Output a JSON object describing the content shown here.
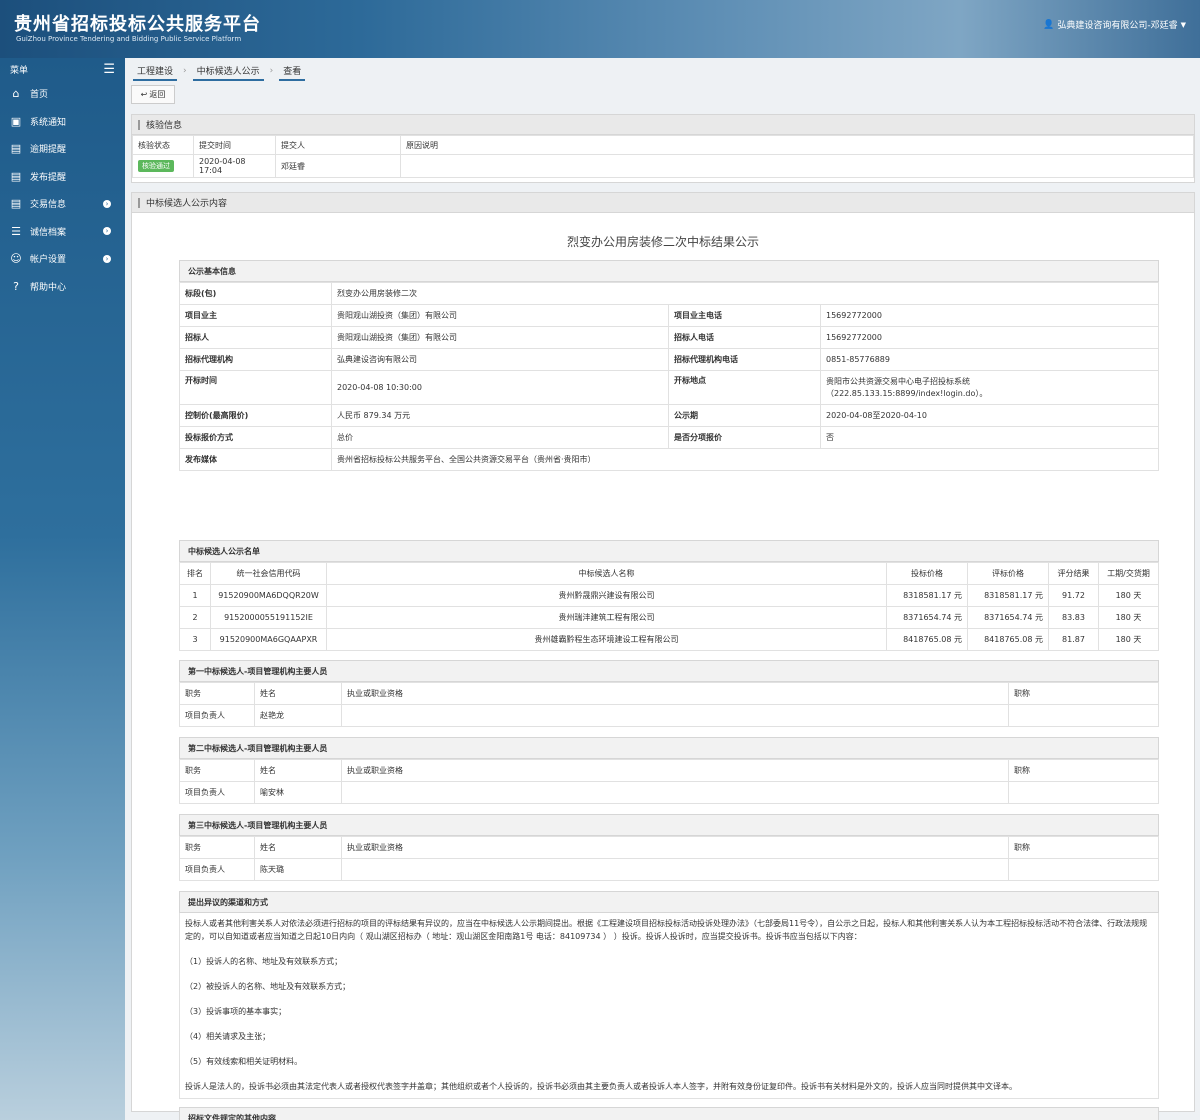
{
  "header": {
    "title": "贵州省招标投标公共服务平台",
    "subtitle": "GuiZhou Province Tendering and Bidding Public Service Platform",
    "user": "弘典建设咨询有限公司-邓廷睿"
  },
  "sidebar": {
    "menu_label": "菜单",
    "items": [
      {
        "label": "首页",
        "icon": "home-icon",
        "expand": false
      },
      {
        "label": "系统通知",
        "icon": "monitor-icon",
        "expand": false
      },
      {
        "label": "逾期提醒",
        "icon": "folder-icon",
        "expand": false
      },
      {
        "label": "发布提醒",
        "icon": "folder-icon",
        "expand": false
      },
      {
        "label": "交易信息",
        "icon": "folder-icon",
        "expand": true
      },
      {
        "label": "诚信档案",
        "icon": "list-icon",
        "expand": true
      },
      {
        "label": "帐户设置",
        "icon": "user-icon",
        "expand": true
      },
      {
        "label": "帮助中心",
        "icon": "help-icon",
        "expand": false
      }
    ]
  },
  "breadcrumb": [
    "工程建设",
    "中标候选人公示",
    "查看"
  ],
  "back_label": "返回",
  "verify": {
    "title": "核验信息",
    "headers": [
      "核验状态",
      "提交时间",
      "提交人",
      "原因说明"
    ],
    "status": "核验通过",
    "time": "2020-04-08 17:04",
    "person": "邓廷睿",
    "reason": ""
  },
  "content": {
    "panel_title": "中标候选人公示内容",
    "doc_title": "烈变办公用房装修二次中标结果公示",
    "basic": {
      "title": "公示基本信息",
      "bid_section_label": "标段(包)",
      "bid_section": "烈变办公用房装修二次",
      "rows": [
        {
          "l1": "项目业主",
          "v1": "贵阳观山湖投资（集团）有限公司",
          "l2": "项目业主电话",
          "v2": "15692772000"
        },
        {
          "l1": "招标人",
          "v1": "贵阳观山湖投资（集团）有限公司",
          "l2": "招标人电话",
          "v2": "15692772000"
        },
        {
          "l1": "招标代理机构",
          "v1": "弘典建设咨询有限公司",
          "l2": "招标代理机构电话",
          "v2": "0851-85776889"
        },
        {
          "l1": "开标时间",
          "v1": "2020-04-08 10:30:00",
          "l2": "开标地点",
          "v2": "贵阳市公共资源交易中心电子招投标系统",
          "v2b": "（222.85.133.15:8899/index!login.do）。"
        },
        {
          "l1": "控制价(最高限价)",
          "v1": "人民币 879.34 万元",
          "l2": "公示期",
          "v2": "2020-04-08至2020-04-10"
        },
        {
          "l1": "投标报价方式",
          "v1": "总价",
          "l2": "是否分项报价",
          "v2": "否"
        }
      ],
      "media_label": "发布媒体",
      "media": "贵州省招标投标公共服务平台、全国公共资源交易平台（贵州省·贵阳市）"
    },
    "candidates": {
      "title": "中标候选人公示名单",
      "headers": [
        "排名",
        "统一社会信用代码",
        "中标候选人名称",
        "投标价格",
        "评标价格",
        "评分结果",
        "工期/交货期"
      ],
      "rows": [
        {
          "rank": "1",
          "code": "91520900MA6DQQR20W",
          "name": "贵州黔晟鼎兴建设有限公司",
          "bid": "8318581.17 元",
          "eval": "8318581.17 元",
          "score": "91.72",
          "period": "180 天"
        },
        {
          "rank": "2",
          "code": "915200005519115​2IE",
          "name": "贵州瑞沣建筑工程有限公司",
          "bid": "8371654.74 元",
          "eval": "8371654.74 元",
          "score": "83.83",
          "period": "180 天"
        },
        {
          "rank": "3",
          "code": "91520900MA6GQAAPXR",
          "name": "贵州雄霸黔程生态环境建设工程有限公司",
          "bid": "8418765.08 元",
          "eval": "8418765.08 元",
          "score": "81.87",
          "period": "180 天"
        }
      ]
    },
    "managers": [
      {
        "title": "第一中标候选人-项目管理机构主要人员",
        "headers": [
          "职务",
          "姓名",
          "执业或职业资格",
          "职称"
        ],
        "role": "项目负责人",
        "name": "赵艳龙",
        "qual": "",
        "rank": ""
      },
      {
        "title": "第二中标候选人-项目管理机构主要人员",
        "headers": [
          "职务",
          "姓名",
          "执业或职业资格",
          "职称"
        ],
        "role": "项目负责人",
        "name": "喻安林",
        "qual": "",
        "rank": ""
      },
      {
        "title": "第三中标候选人-项目管理机构主要人员",
        "headers": [
          "职务",
          "姓名",
          "执业或职业资格",
          "职称"
        ],
        "role": "项目负责人",
        "name": "陈天璐",
        "qual": "",
        "rank": ""
      }
    ],
    "objection": {
      "title": "提出异议的渠道和方式",
      "paragraphs": [
        "投标人或者其他利害关系人对依法必须进行招标的项目的评标结果有异议的，应当在中标候选人公示期间提出。根据《工程建设项目招标投标活动投诉处理办法》（七部委局11号令），自公示之日起，投标人和其他利害关系人认为本工程招标投标活动不符合法律、行政法规规定的，可以自知道或者应当知道之日起10日内向（ 观山湖区招标办（ 地址：观山湖区金阳南路1号 电话：84109734 ） ）投诉。投诉人投诉时，应当提交投诉书。投诉书应当包括以下内容：",
        "（1）投诉人的名称、地址及有效联系方式；",
        "（2）被投诉人的名称、地址及有效联系方式；",
        "（3）投诉事项的基本事实；",
        "（4）相关请求及主张；",
        "（5）有效线索和相关证明材料。",
        "投诉人是法人的，投诉书必须由其法定代表人或者授权代表签字并盖章；其他组织或者个人投诉的，投诉书必须由其主要负责人或者投诉人本人签字，并附有效身份证复印件。投诉书有关材料是外文的，投诉人应当同时提供其中文译本。"
      ]
    },
    "other": {
      "title": "招标文件规定的其他内容",
      "value": "/"
    }
  }
}
